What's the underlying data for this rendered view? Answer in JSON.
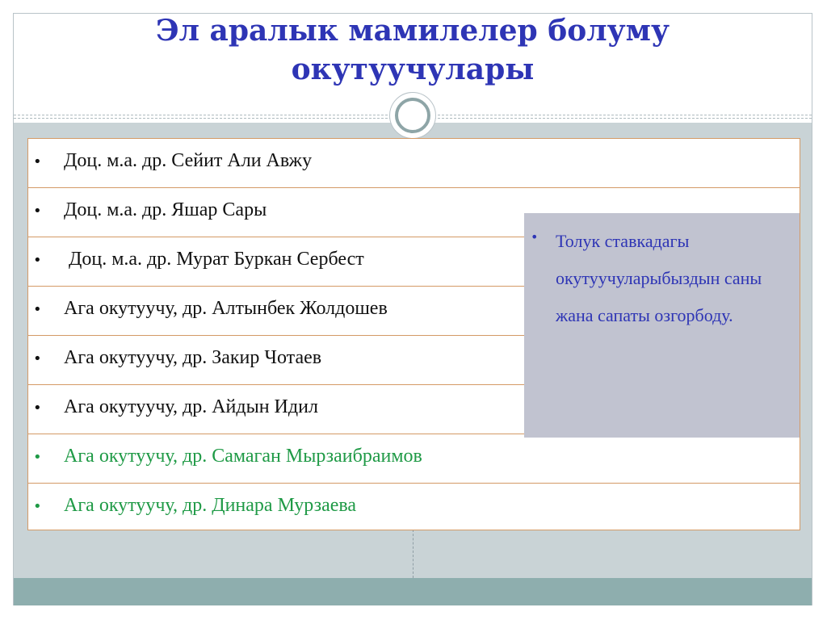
{
  "slide": {
    "title_line1": "Эл аралык мамилелер болуму",
    "title_line2": "окутуучулары"
  },
  "staff_list": {
    "bullet": "•",
    "items": [
      {
        "text": "Доц. м.а. др. Сейит Али Авжу",
        "color": "#111111"
      },
      {
        "text": "Доц. м.а. др. Яшар Сары",
        "color": "#111111"
      },
      {
        "text": " Доц. м.а. др. Мурат Буркан Сербест",
        "color": "#111111"
      },
      {
        "text": "Ага окутуучу, др. Алтынбек Жолдошев",
        "color": "#111111"
      },
      {
        "text": "Ага окутуучу, др. Закир Чотаев",
        "color": "#111111"
      },
      {
        "text": "Ага окутуучу, др. Айдын Идил",
        "color": "#111111"
      },
      {
        "text": "Ага окутуучу, др. Самаган Мырзаибраимов",
        "color": "#1f9a46"
      },
      {
        "text": "Ага окутуучу, др. Динара Мурзаева",
        "color": "#1f9a46"
      }
    ]
  },
  "note": {
    "bullet": "•",
    "text": "Толук ставкадагы окутуучуларыбыздын саны жана сапаты озгорбоду."
  },
  "colors": {
    "title": "#2e35b5",
    "note_text": "#2e35b5",
    "note_bg": "#c1c3d0",
    "table_border": "#d49a66",
    "body_bg": "#c9d3d6",
    "footer_band": "#8eaeae",
    "green_text": "#1f9a46"
  }
}
